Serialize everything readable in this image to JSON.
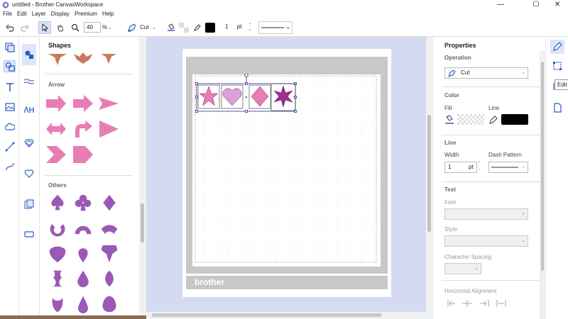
{
  "window": {
    "title": "untitled - Brother CanvasWorkspace",
    "min": "—",
    "max": "☐",
    "close": "✕"
  },
  "menu": [
    "File",
    "Edit",
    "Layer",
    "Display",
    "Premium",
    "Help"
  ],
  "toolbar": {
    "zoom_value": "40",
    "zoom_unit": "%",
    "operation": "Cut",
    "line_width": "1",
    "line_unit": "pt"
  },
  "shapes_panel": {
    "title": "Shapes",
    "sections": {
      "arrow": "Arrow",
      "others": "Others"
    }
  },
  "canvas": {
    "brand": "brother"
  },
  "properties": {
    "title": "Properties",
    "operation_label": "Operation",
    "operation_value": "Cut",
    "color_label": "Color",
    "fill_label": "Fill",
    "line_label": "Line",
    "line_section": "Line",
    "width_label": "Width",
    "width_value": "1",
    "width_unit": "pt",
    "dash_label": "Dash Pattern",
    "text_section": "Text",
    "font_label": "Font",
    "style_label": "Style",
    "char_spacing_label": "Character Spacing",
    "halign_label": "Horizontal Alignment"
  },
  "tooltip": "Edit",
  "colors": {
    "accent": "#2b59c3",
    "shape_pink": "#e77db5",
    "shape_purple": "#9b59b6",
    "canvas_bg": "#d4daf1",
    "mat_gray": "#c8c8c8"
  },
  "icons": [
    "undo-icon",
    "redo-icon",
    "select-icon",
    "pan-icon",
    "zoom-icon",
    "pen-icon",
    "fill-icon",
    "color-swatch-icon"
  ]
}
